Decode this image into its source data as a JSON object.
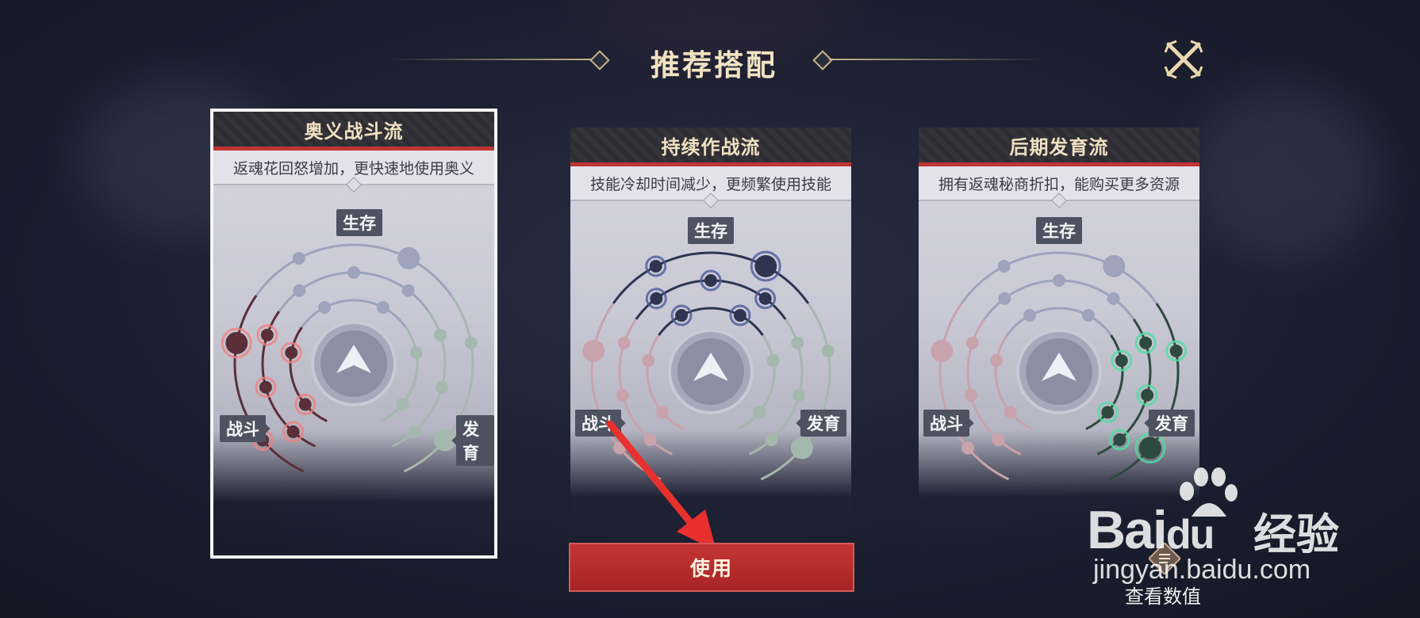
{
  "header": {
    "title": "推荐搭配"
  },
  "cards": [
    {
      "name": "奥义战斗流",
      "desc": "返魂花回怒增加，更快速地使用奥义",
      "top_tag": "生存",
      "left_tag": "战斗",
      "right_tag": "发育",
      "highlight": "combat",
      "selected": true
    },
    {
      "name": "持续作战流",
      "desc": "技能冷却时间减少，更频繁使用技能",
      "top_tag": "生存",
      "left_tag": "战斗",
      "right_tag": "发育",
      "highlight": "survival",
      "selected": false
    },
    {
      "name": "后期发育流",
      "desc": "拥有返魂秘商折扣，能购买更多资源",
      "top_tag": "生存",
      "left_tag": "战斗",
      "right_tag": "发育",
      "highlight": "growth",
      "selected": false
    }
  ],
  "use_button": {
    "label": "使用"
  },
  "view_values": {
    "label": "查看数值",
    "icon": "list-icon"
  },
  "watermark": {
    "brand": "Bai",
    "brand_du": "du",
    "cn": "经验",
    "url": "jingyan.baidu.com"
  },
  "colors": {
    "accent_red": "#c13434",
    "gold": "#c7b38a",
    "combat": "#f08080",
    "survival": "#4a5a9a",
    "growth": "#4fe0a0"
  }
}
